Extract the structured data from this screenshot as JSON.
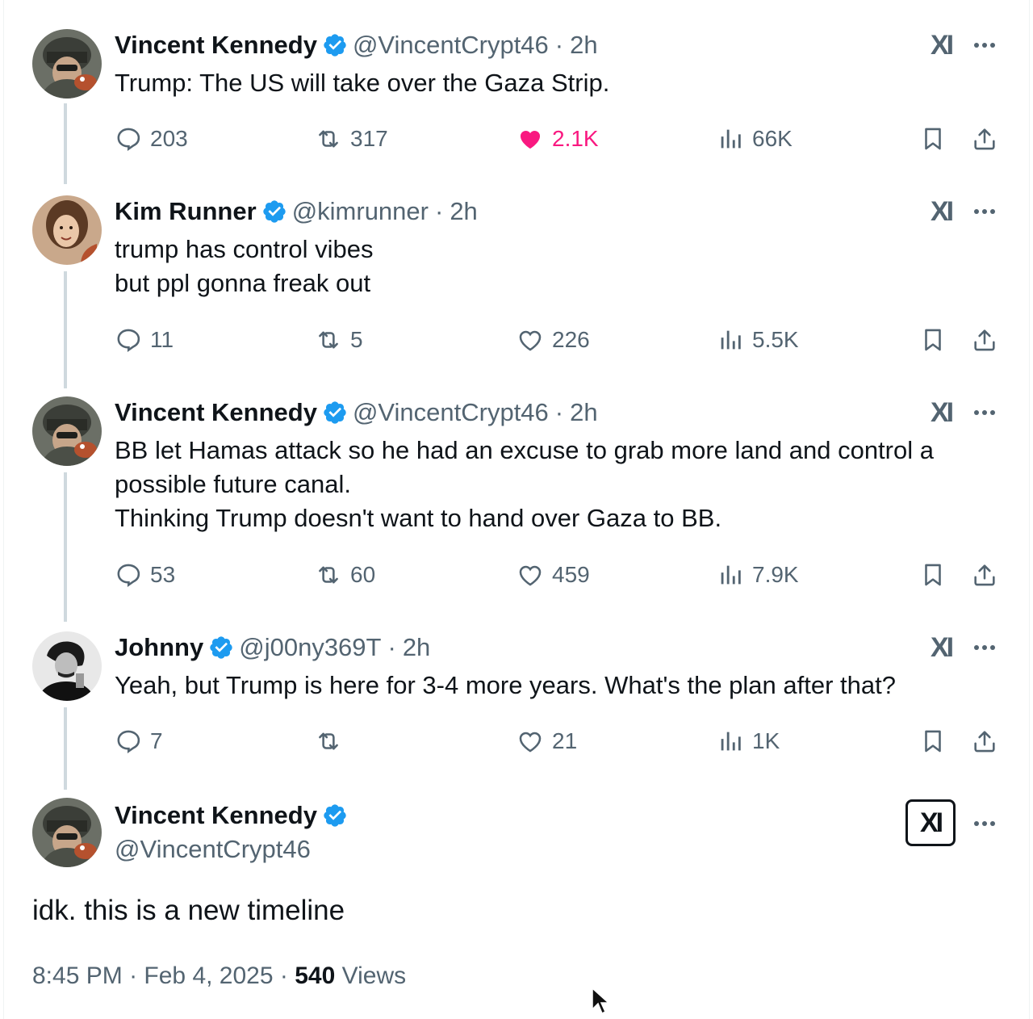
{
  "tweets": [
    {
      "name": "Vincent Kennedy",
      "handle": "@VincentCrypt46",
      "time": "2h",
      "text_lines": [
        "Trump: The US will take over the Gaza Strip."
      ],
      "replies": "203",
      "reposts": "317",
      "likes": "2.1K",
      "liked": true,
      "views": "66K"
    },
    {
      "name": "Kim Runner",
      "handle": "@kimrunner",
      "time": "2h",
      "text_lines": [
        "trump has control vibes",
        "but ppl gonna freak out"
      ],
      "replies": "11",
      "reposts": "5",
      "likes": "226",
      "liked": false,
      "views": "5.5K"
    },
    {
      "name": "Vincent Kennedy",
      "handle": "@VincentCrypt46",
      "time": "2h",
      "text_lines": [
        "BB let Hamas attack so he had an excuse to grab more land and control a",
        "possible future canal.",
        "Thinking Trump doesn't want to hand over Gaza to BB."
      ],
      "replies": "53",
      "reposts": "60",
      "likes": "459",
      "liked": false,
      "views": "7.9K"
    },
    {
      "name": "Johnny",
      "handle": "@j00ny369T",
      "time": "2h",
      "text_lines": [
        "Yeah, but Trump is here for 3-4 more years. What's the plan after that?"
      ],
      "replies": "7",
      "reposts": "",
      "likes": "21",
      "liked": false,
      "views": "1K"
    }
  ],
  "main_tweet": {
    "name": "Vincent Kennedy",
    "handle": "@VincentCrypt46",
    "text": "idk. this is a new timeline",
    "time": "8:45 PM",
    "date": "Feb 4, 2025",
    "views_count": "540",
    "views_label": "Views"
  },
  "ui": {
    "separator": "·",
    "grok_label": "XΙ"
  },
  "colors": {
    "verified": "#1d9bf0",
    "like_active": "#f91880",
    "muted": "#536471"
  }
}
